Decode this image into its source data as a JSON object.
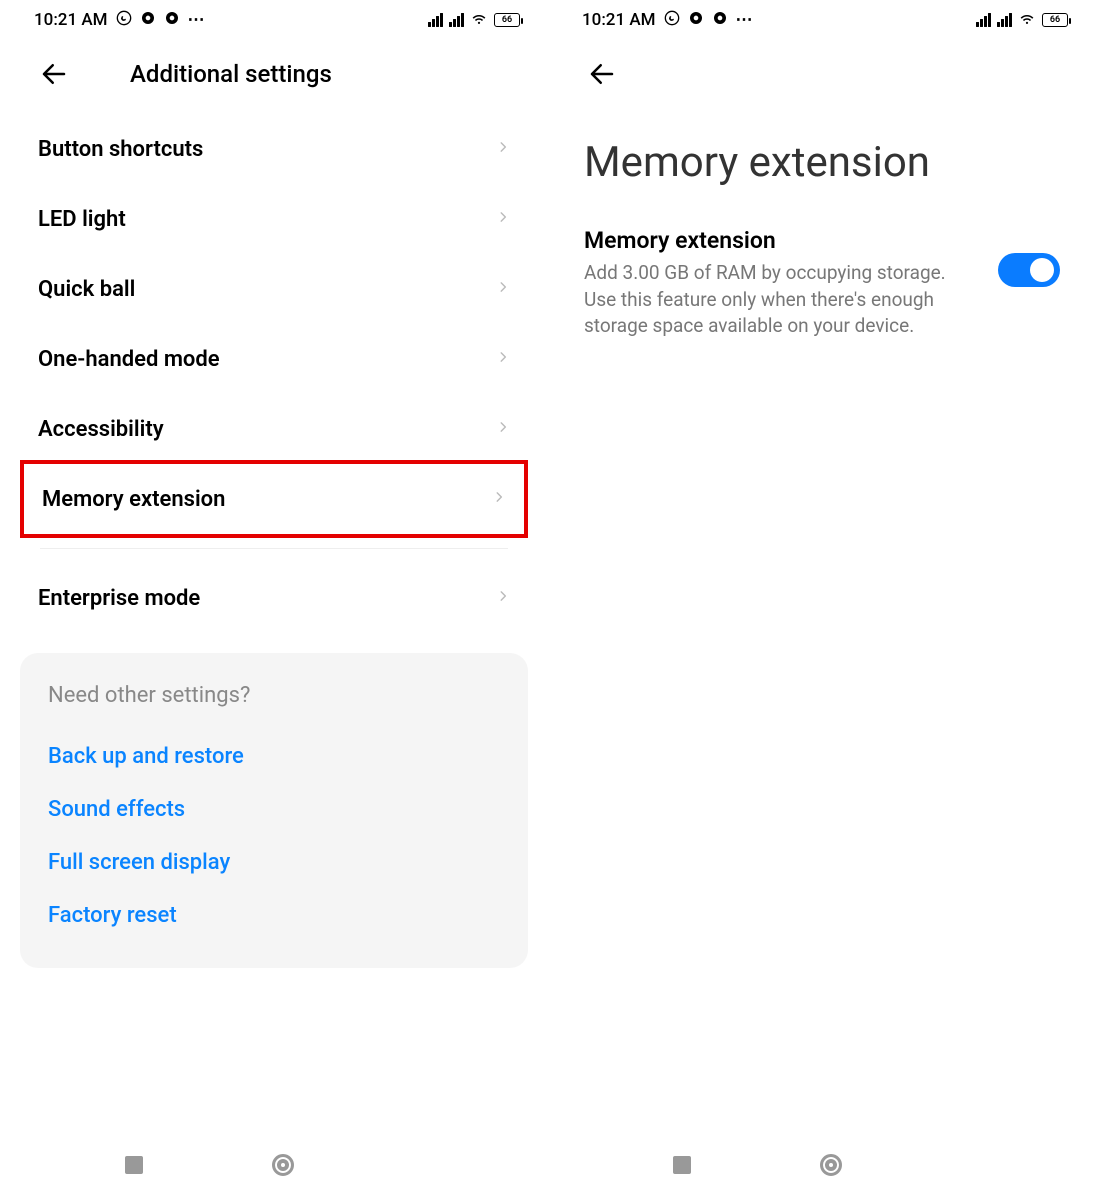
{
  "status": {
    "time": "10:21 AM",
    "battery": "66"
  },
  "left": {
    "title": "Additional settings",
    "items": [
      "Button shortcuts",
      "LED light",
      "Quick ball",
      "One-handed mode",
      "Accessibility",
      "Memory extension",
      "Enterprise mode"
    ],
    "card": {
      "title": "Need other settings?",
      "links": [
        "Back up and restore",
        "Sound effects",
        "Full screen display",
        "Factory reset"
      ]
    }
  },
  "right": {
    "page_title": "Memory extension",
    "setting": {
      "title": "Memory extension",
      "description": "Add 3.00 GB of RAM by occupying storage. Use this feature only when there's enough storage space available on your device.",
      "enabled": true
    }
  }
}
